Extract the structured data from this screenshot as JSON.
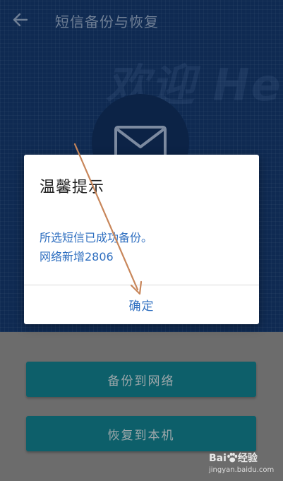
{
  "appbar": {
    "title": "短信备份与恢复",
    "back_icon": "arrow-left-icon"
  },
  "background": {
    "watermark_text": "欢迎 Hello D",
    "hero_icon": "mail-envelope-icon",
    "colors": {
      "top": "#0f2a52",
      "bottom": "#6c6c6c",
      "button": "#0d5f6a"
    }
  },
  "actions": {
    "backup_label": "备份到网络",
    "restore_label": "恢复到本机"
  },
  "dialog": {
    "title": "温馨提示",
    "message_line1": "所选短信已成功备份。",
    "message_line2": "网络新增2806",
    "confirm_label": "确定",
    "accent": "#2f6fc0"
  },
  "annotation": {
    "type": "arrow",
    "color": "#c8865a"
  },
  "watermark": {
    "brand": "Bai",
    "brand_suffix": "经验",
    "url": "jingyan.baidu.com"
  }
}
